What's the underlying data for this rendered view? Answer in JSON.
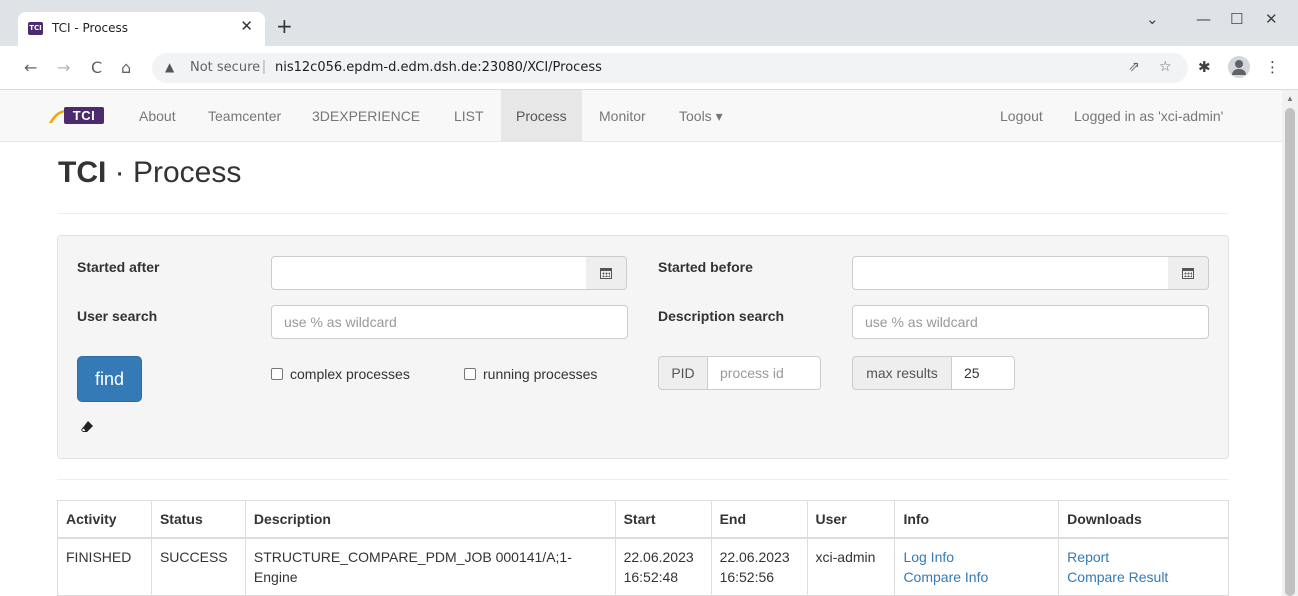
{
  "browser": {
    "tab_title": "TCI - Process",
    "tab_favicon_text": "TCI",
    "tab_close": "✕",
    "new_tab": "+",
    "omnibox": {
      "security_warning": "Not secure",
      "url": "nis12c056.epdm-d.edm.dsh.de:23080/XCI/Process"
    },
    "window_controls": {
      "dropdown": "⌄",
      "minimize": "—",
      "maximize": "☐",
      "close": "✕"
    },
    "nav": {
      "back": "←",
      "forward": "→",
      "reload": "C",
      "home": "⌂"
    }
  },
  "navbar": {
    "brand": "TCI",
    "items": [
      {
        "label": "About",
        "active": false
      },
      {
        "label": "Teamcenter",
        "active": false
      },
      {
        "label": "3DEXPERIENCE",
        "active": false
      },
      {
        "label": "LIST",
        "active": false
      },
      {
        "label": "Process",
        "active": true
      },
      {
        "label": "Monitor",
        "active": false
      },
      {
        "label": "Tools ▾",
        "active": false
      }
    ],
    "logout": "Logout",
    "logged_in": "Logged in as 'xci-admin'"
  },
  "page": {
    "title_brand": "TCI",
    "title_rest": " · Process"
  },
  "filters": {
    "started_after_label": "Started after",
    "started_after_value": "",
    "started_before_label": "Started before",
    "started_before_value": "",
    "user_search_label": "User search",
    "user_search_placeholder": "use % as wildcard",
    "description_search_label": "Description search",
    "description_search_placeholder": "use % as wildcard",
    "find_label": "find",
    "complex_processes_label": "complex processes",
    "running_processes_label": "running processes",
    "pid_label": "PID",
    "pid_placeholder": "process id",
    "max_results_label": "max results",
    "max_results_value": "25"
  },
  "table": {
    "headers": [
      "Activity",
      "Status",
      "Description",
      "Start",
      "End",
      "User",
      "Info",
      "Downloads"
    ],
    "rows": [
      {
        "activity": "FINISHED",
        "status": "SUCCESS",
        "description": "STRUCTURE_COMPARE_PDM_JOB 000141/A;1-Engine",
        "start": "22.06.2023 16:52:48",
        "end": "22.06.2023 16:52:56",
        "user": "xci-admin",
        "info_links": [
          "Log Info",
          "Compare Info"
        ],
        "download_links": [
          "Report",
          "Compare Result"
        ]
      }
    ]
  }
}
